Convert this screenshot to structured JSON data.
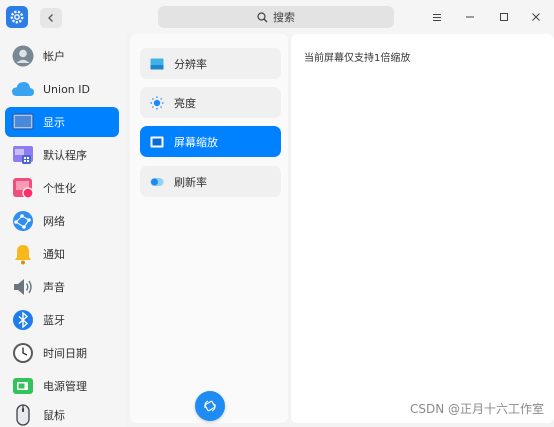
{
  "titlebar": {
    "search_placeholder": "搜索"
  },
  "sidebar": {
    "items": [
      {
        "label": "帐户",
        "icon": "account-icon"
      },
      {
        "label": "Union ID",
        "icon": "cloud-icon"
      },
      {
        "label": "显示",
        "icon": "display-icon"
      },
      {
        "label": "默认程序",
        "icon": "default-apps-icon"
      },
      {
        "label": "个性化",
        "icon": "personalization-icon"
      },
      {
        "label": "网络",
        "icon": "network-icon"
      },
      {
        "label": "通知",
        "icon": "bell-icon"
      },
      {
        "label": "声音",
        "icon": "speaker-icon"
      },
      {
        "label": "蓝牙",
        "icon": "bluetooth-icon"
      },
      {
        "label": "时间日期",
        "icon": "clock-icon"
      },
      {
        "label": "电源管理",
        "icon": "battery-icon"
      },
      {
        "label": "鼠标",
        "icon": "mouse-icon"
      }
    ]
  },
  "display_menu": {
    "items": [
      {
        "label": "分辨率",
        "icon": "resolution-icon"
      },
      {
        "label": "亮度",
        "icon": "brightness-icon"
      },
      {
        "label": "屏幕缩放",
        "icon": "scale-icon"
      },
      {
        "label": "刷新率",
        "icon": "refresh-rate-icon"
      }
    ]
  },
  "content": {
    "info": "当前屏幕仅支持1倍缩放"
  },
  "watermark": "CSDN @正月十六工作室",
  "colors": {
    "accent": "#0081ff"
  }
}
